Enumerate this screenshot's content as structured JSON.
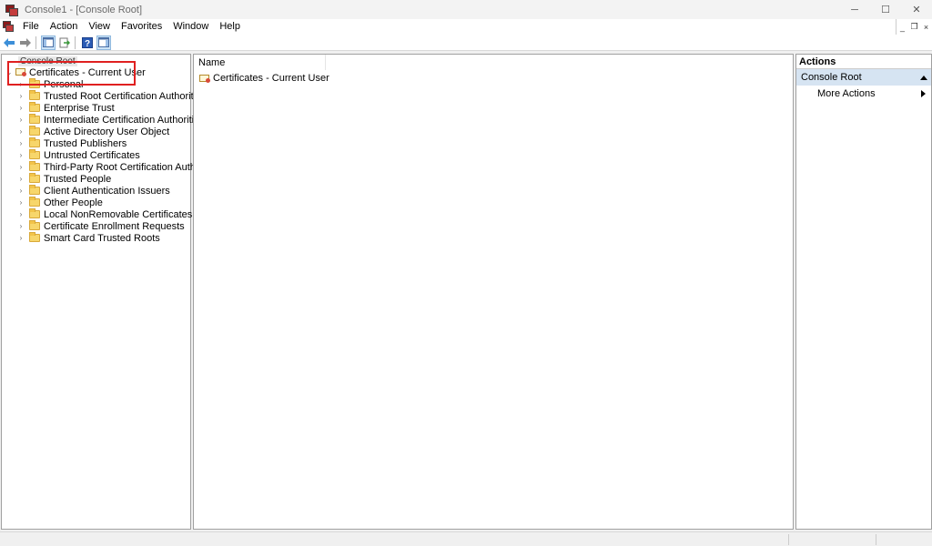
{
  "window": {
    "title": "Console1 - [Console Root]",
    "controls": {
      "minimize": "─",
      "maximize": "☐",
      "close": "✕"
    }
  },
  "menu": {
    "items": [
      "File",
      "Action",
      "View",
      "Favorites",
      "Window",
      "Help"
    ],
    "mdi": {
      "minimize": "_",
      "restore": "❐",
      "close": "×"
    }
  },
  "toolbar": {
    "buttons": [
      "back-arrow-icon",
      "forward-arrow-icon",
      "show-hide-console-tree-icon",
      "export-list-icon",
      "help-icon",
      "show-hide-action-pane-icon"
    ]
  },
  "tree": {
    "root": "Console Root",
    "snapin": "Certificates - Current User",
    "folders": [
      "Personal",
      "Trusted Root Certification Authorities",
      "Enterprise Trust",
      "Intermediate Certification Authorities",
      "Active Directory User Object",
      "Trusted Publishers",
      "Untrusted Certificates",
      "Third-Party Root Certification Authorities",
      "Trusted People",
      "Client Authentication Issuers",
      "Other People",
      "Local NonRemovable Certificates",
      "Certificate Enrollment Requests",
      "Smart Card Trusted Roots"
    ]
  },
  "list": {
    "column_name": "Name",
    "rows": [
      "Certificates - Current User"
    ]
  },
  "actions": {
    "title": "Actions",
    "section": "Console Root",
    "items": [
      "More Actions"
    ]
  },
  "colors": {
    "highlight": "#e02020",
    "actions_section_bg": "#d6e4f2",
    "folder": "#f7d66b"
  }
}
